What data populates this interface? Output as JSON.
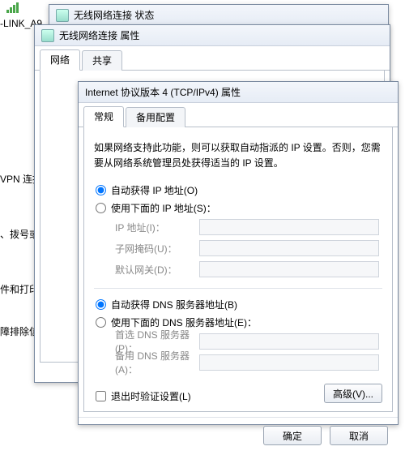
{
  "desktop": {
    "shortcut_label": "-LINK_A9",
    "sidebar_vpn": "VPN 连持",
    "sidebar_dial": "、拨号或",
    "sidebar_print": "件和打印",
    "sidebar_trouble": "障排除信"
  },
  "back_window1": {
    "title": "无线网络连接 状态"
  },
  "back_window2": {
    "title": "无线网络连接 属性",
    "tabs": {
      "network": "网络",
      "share": "共享"
    }
  },
  "ipv4": {
    "title": "Internet 协议版本 4 (TCP/IPv4) 属性",
    "tabs": {
      "general": "常规",
      "alt": "备用配置"
    },
    "desc": "如果网络支持此功能，则可以获取自动指派的 IP 设置。否则，您需要从网络系统管理员处获得适当的 IP 设置。",
    "ip": {
      "auto": "自动获得 IP 地址(O)",
      "manual": "使用下面的 IP 地址(S)：",
      "addr_label": "IP 地址(I)：",
      "mask_label": "子网掩码(U)：",
      "gw_label": "默认网关(D)："
    },
    "dns": {
      "auto": "自动获得 DNS 服务器地址(B)",
      "manual": "使用下面的 DNS 服务器地址(E)：",
      "pref_label": "首选 DNS 服务器(P)：",
      "alt_label": "备用 DNS 服务器(A)："
    },
    "validate_on_exit": "退出时验证设置(L)",
    "advanced_btn": "高级(V)...",
    "ok_btn": "确定",
    "cancel_btn": "取消"
  }
}
